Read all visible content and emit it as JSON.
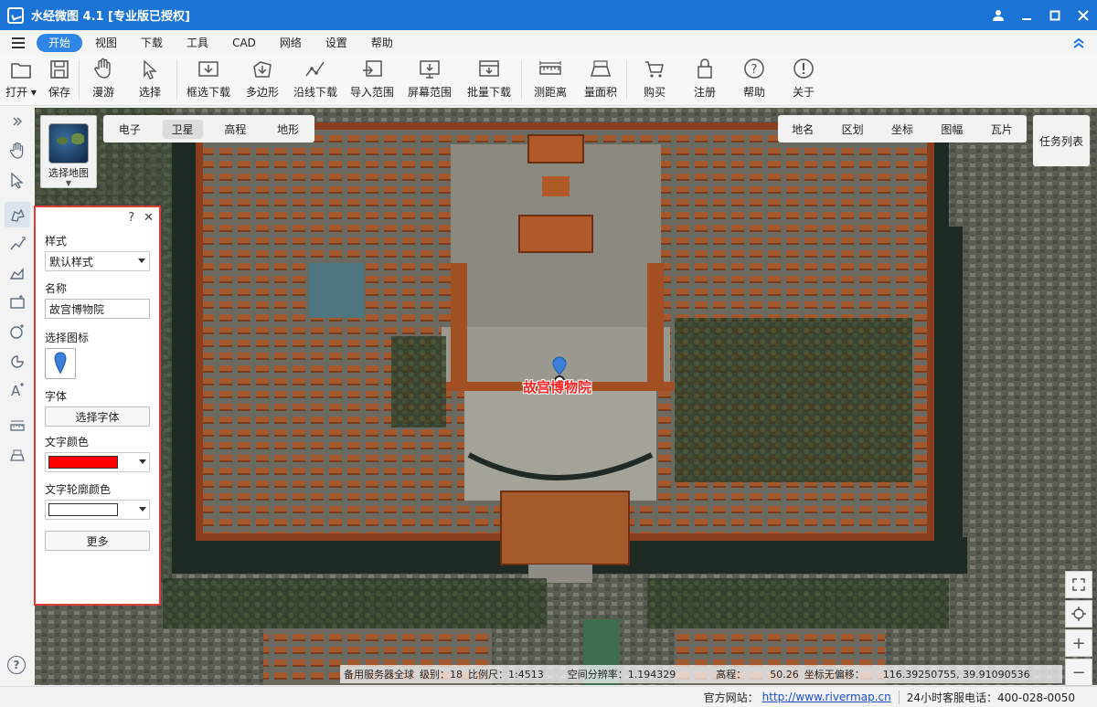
{
  "window": {
    "title": "水经微图 4.1 [专业版已授权]"
  },
  "menu": {
    "items": [
      "开始",
      "视图",
      "下载",
      "工具",
      "CAD",
      "网络",
      "设置",
      "帮助"
    ],
    "active_index": 0
  },
  "toolbar": {
    "tools": [
      {
        "label": "打开",
        "icon": "folder-icon"
      },
      {
        "label": "保存",
        "icon": "save-icon"
      },
      {
        "label": "漫游",
        "icon": "hand-icon"
      },
      {
        "label": "选择",
        "icon": "pointer-icon"
      },
      {
        "label": "框选下载",
        "icon": "rect-download-icon"
      },
      {
        "label": "多边形",
        "icon": "polygon-download-icon"
      },
      {
        "label": "沿线下载",
        "icon": "line-download-icon"
      },
      {
        "label": "导入范围",
        "icon": "import-range-icon"
      },
      {
        "label": "屏幕范围",
        "icon": "screen-range-icon"
      },
      {
        "label": "批量下载",
        "icon": "batch-download-icon"
      },
      {
        "label": "测距离",
        "icon": "ruler-icon"
      },
      {
        "label": "量面积",
        "icon": "area-icon"
      },
      {
        "label": "购买",
        "icon": "cart-icon"
      },
      {
        "label": "注册",
        "icon": "lock-icon"
      },
      {
        "label": "帮助",
        "icon": "help-icon"
      },
      {
        "label": "关于",
        "icon": "info-icon"
      }
    ]
  },
  "map_controls": {
    "select_map_label": "选择地图",
    "map_types": [
      "电子",
      "卫星",
      "高程",
      "地形"
    ],
    "active_map_type": "卫星",
    "layers": [
      "地名",
      "区划",
      "坐标",
      "图幅",
      "瓦片"
    ],
    "task_list": "任务列表"
  },
  "style_panel": {
    "help": "?",
    "close": "✕",
    "style_label": "样式",
    "style_value": "默认样式",
    "name_label": "名称",
    "name_value": "故宫博物院",
    "icon_label": "选择图标",
    "font_label": "字体",
    "font_button": "选择字体",
    "text_color_label": "文字颜色",
    "text_color": "#ff0000",
    "outline_color_label": "文字轮廓颜色",
    "outline_color": "#ffffff",
    "more_button": "更多"
  },
  "map": {
    "poi_label": "故宫博物院",
    "poi_color": "#ff2222"
  },
  "status": {
    "server": "备用服务器全球",
    "level_label": "级别：",
    "level": "18",
    "scale_label": "比例尺：",
    "scale": "1:4513",
    "resolution_label": "空间分辨率：",
    "resolution": "1.194329",
    "elevation_label": "高程：",
    "elevation": "50.26",
    "coord_label": "坐标无偏移：",
    "coords": "116.39250755, 39.91090536"
  },
  "footer": {
    "site_label": "官方网站：",
    "site_url": "http://www.rivermap.cn",
    "phone": "24小时客服电话：400-028-0050"
  }
}
